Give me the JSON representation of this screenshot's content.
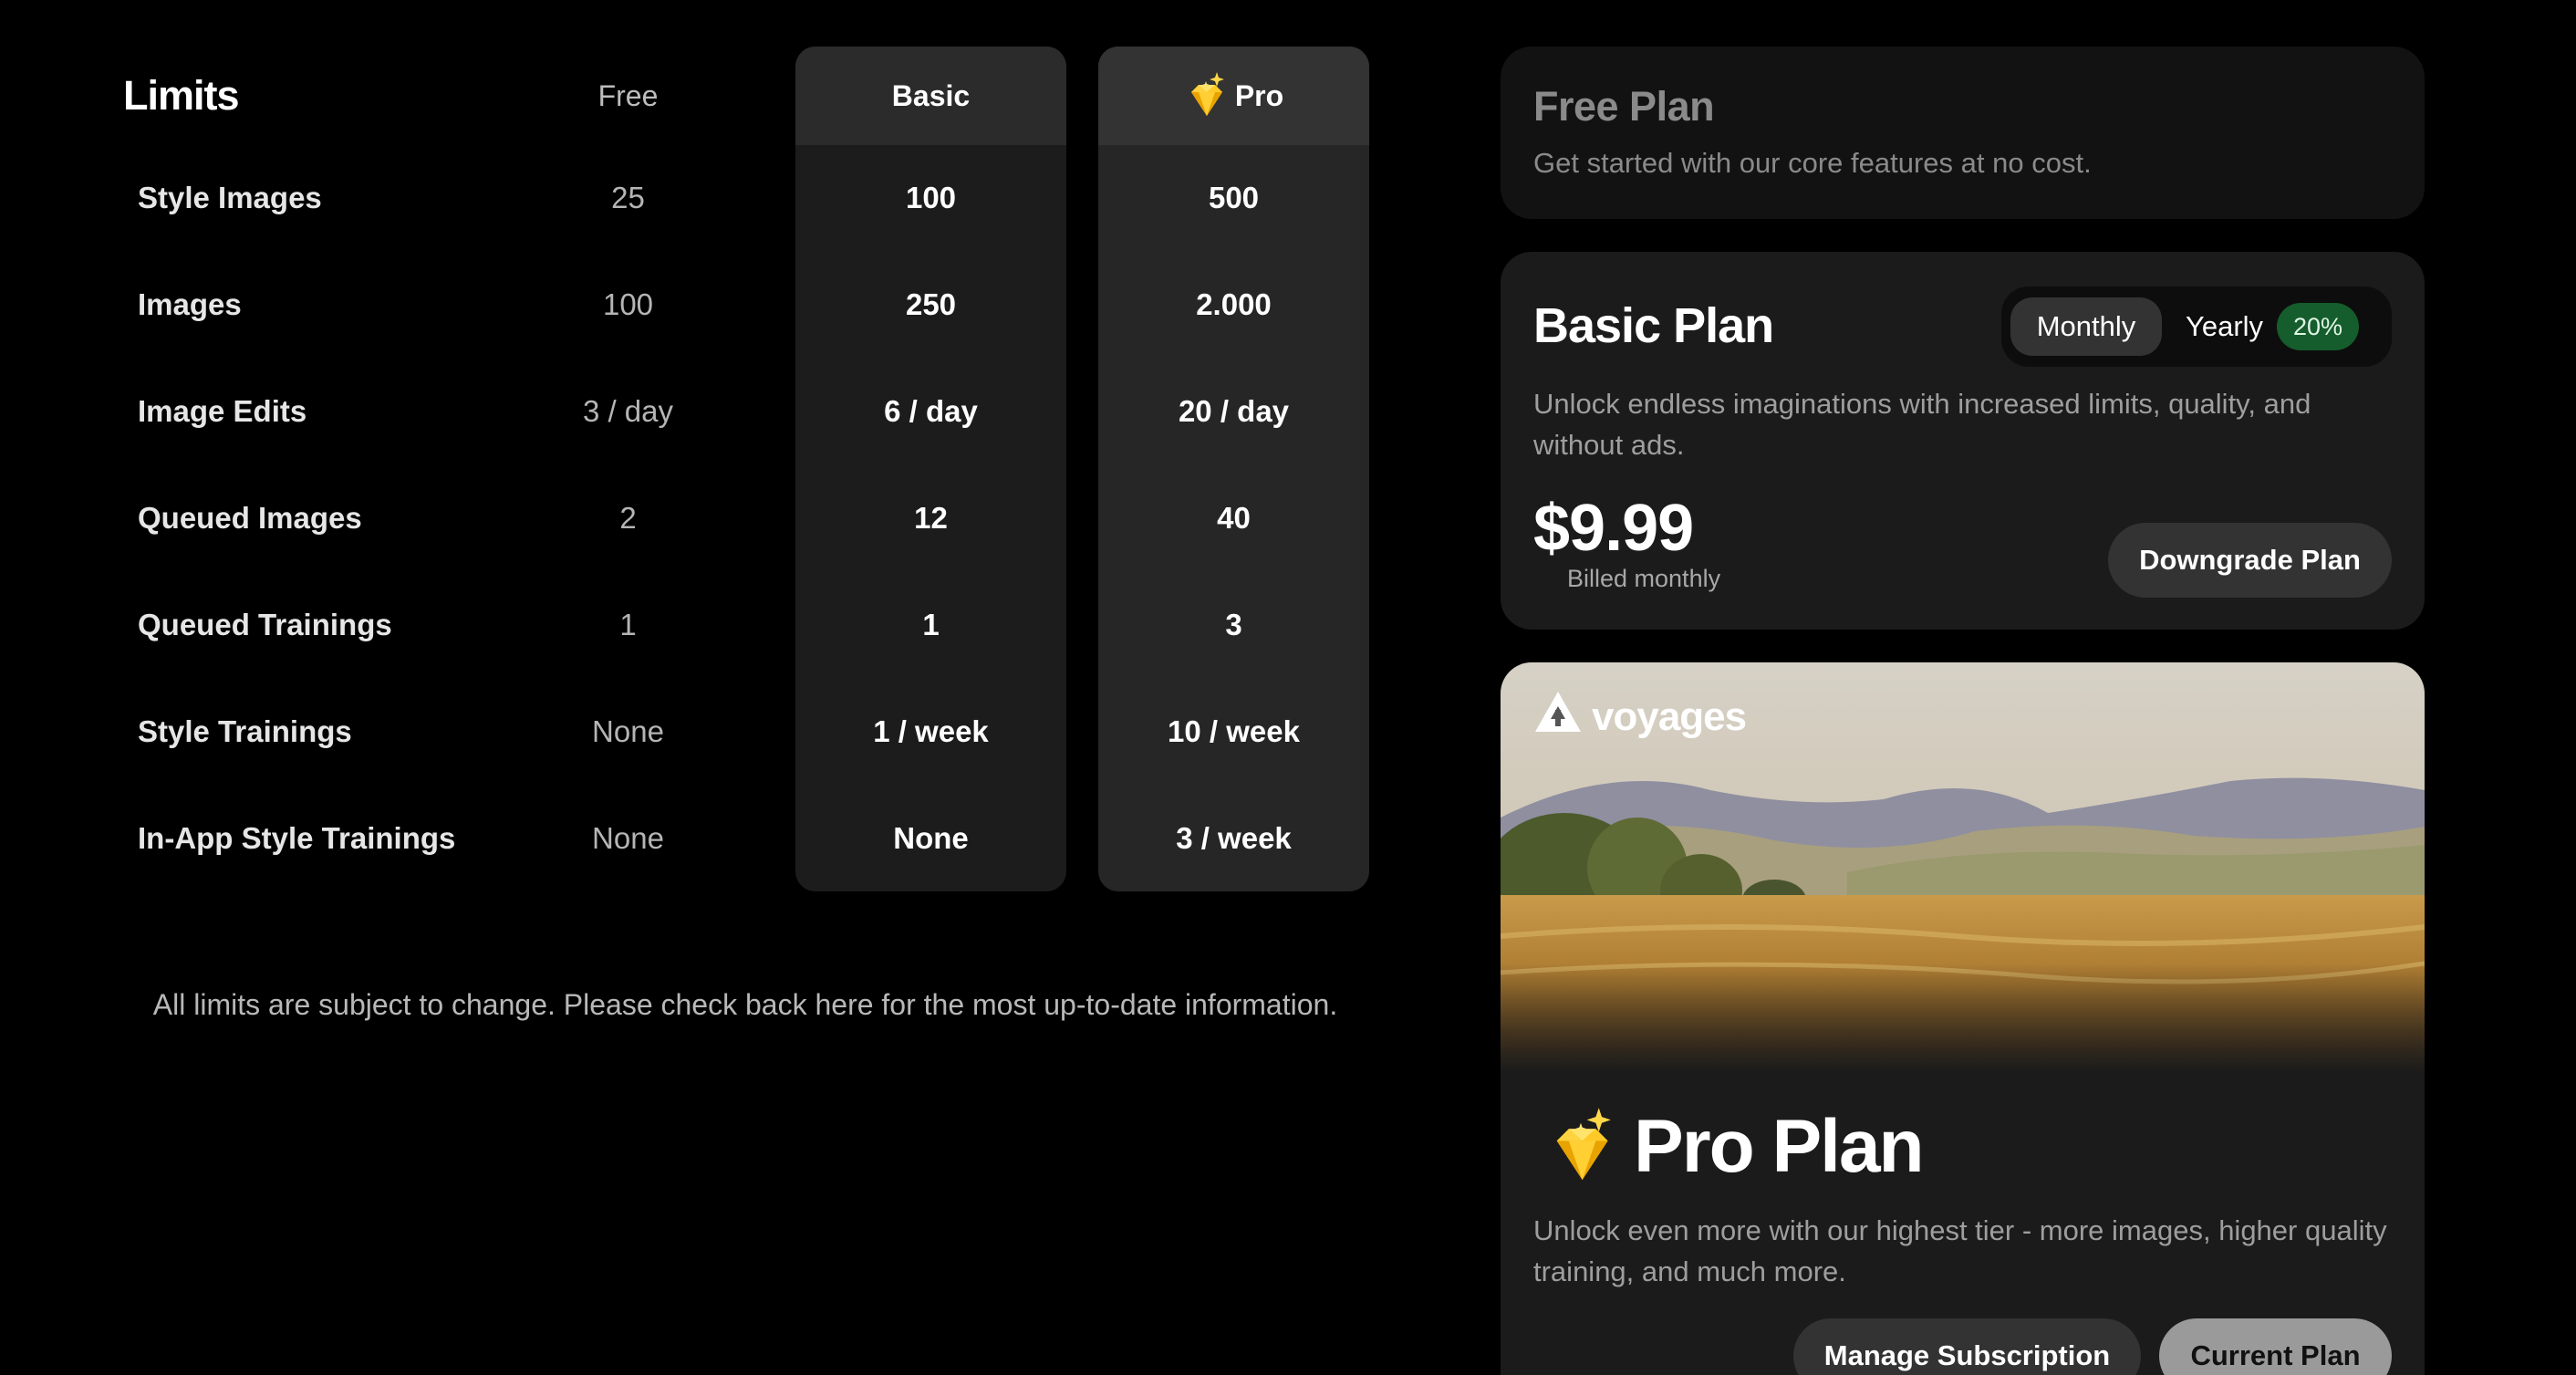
{
  "limits": {
    "title": "Limits",
    "columns": {
      "free": "Free",
      "basic": "Basic",
      "pro": "Pro"
    },
    "rows": [
      {
        "label": "Style Images",
        "free": "25",
        "basic": "100",
        "pro": "500"
      },
      {
        "label": "Images",
        "free": "100",
        "basic": "250",
        "pro": "2.000"
      },
      {
        "label": "Image Edits",
        "free": "3 / day",
        "basic": "6 / day",
        "pro": "20 / day"
      },
      {
        "label": "Queued Images",
        "free": "2",
        "basic": "12",
        "pro": "40"
      },
      {
        "label": "Queued Trainings",
        "free": "1",
        "basic": "1",
        "pro": "3"
      },
      {
        "label": "Style Trainings",
        "free": "None",
        "basic": "1 / week",
        "pro": "10 / week"
      },
      {
        "label": "In-App Style Trainings",
        "free": "None",
        "basic": "None",
        "pro": "3 / week"
      }
    ],
    "disclaimer": "All limits are subject to change. Please check back here for the most up-to-date information."
  },
  "free_plan": {
    "title": "Free Plan",
    "description": "Get started with our core features at no cost."
  },
  "basic_plan": {
    "title": "Basic Plan",
    "toggle": {
      "monthly": "Monthly",
      "yearly": "Yearly",
      "discount": "20%",
      "selected": "Monthly"
    },
    "description": "Unlock endless imaginations with increased limits, quality, and without ads.",
    "price": "$9.99",
    "billing_note": "Billed monthly",
    "action": "Downgrade Plan"
  },
  "pro_plan": {
    "brand": "voyages",
    "title": "Pro Plan",
    "description": "Unlock even more with our highest tier - more images, higher quality training, and much more.",
    "manage_action": "Manage Subscription",
    "current_action": "Current Plan"
  },
  "colors": {
    "background": "#000000",
    "card": "#1b1b1b",
    "discount_badge": "#155d2c",
    "gem": "#f5c518"
  },
  "icons": {
    "pro_badge": "gem-icon",
    "brand_logo": "voyages-logo-icon"
  }
}
